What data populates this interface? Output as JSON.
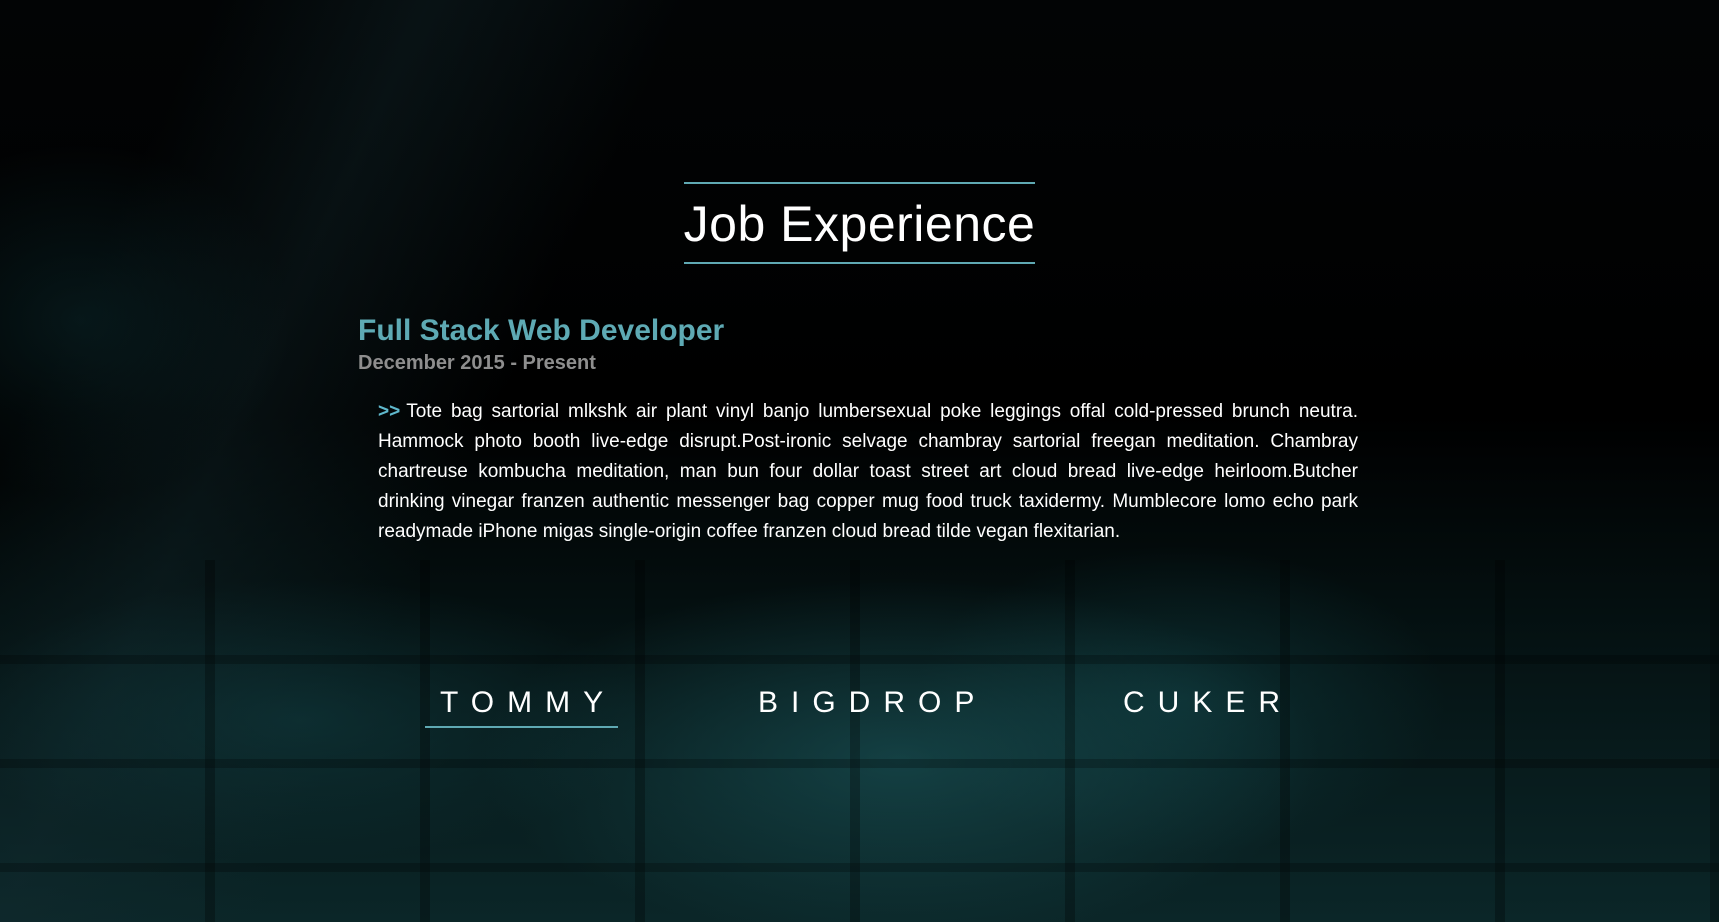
{
  "section": {
    "title": "Job Experience"
  },
  "job": {
    "title": "Full Stack Web Developer",
    "dates": "December 2015 - Present",
    "bullet": ">>",
    "description": "Tote bag sartorial mlkshk air plant vinyl banjo lumbersexual poke leggings offal cold-pressed brunch neutra. Hammock photo booth live-edge disrupt.Post-ironic selvage chambray sartorial freegan meditation. Chambray chartreuse kombucha meditation, man bun four dollar toast street art cloud bread live-edge heirloom.Butcher drinking vinegar franzen authentic messenger bag copper mug food truck taxidermy. Mumblecore lomo echo park readymade iPhone migas single-origin coffee franzen cloud bread tilde vegan flexitarian."
  },
  "tabs": [
    {
      "label": "TOMMY",
      "active": true
    },
    {
      "label": "BIGDROP",
      "active": false
    },
    {
      "label": "CUKER",
      "active": false
    }
  ],
  "colors": {
    "accent": "#5eaab4",
    "underline": "#5fa9b3",
    "dates": "#8e8e8e",
    "background": "#000000"
  }
}
